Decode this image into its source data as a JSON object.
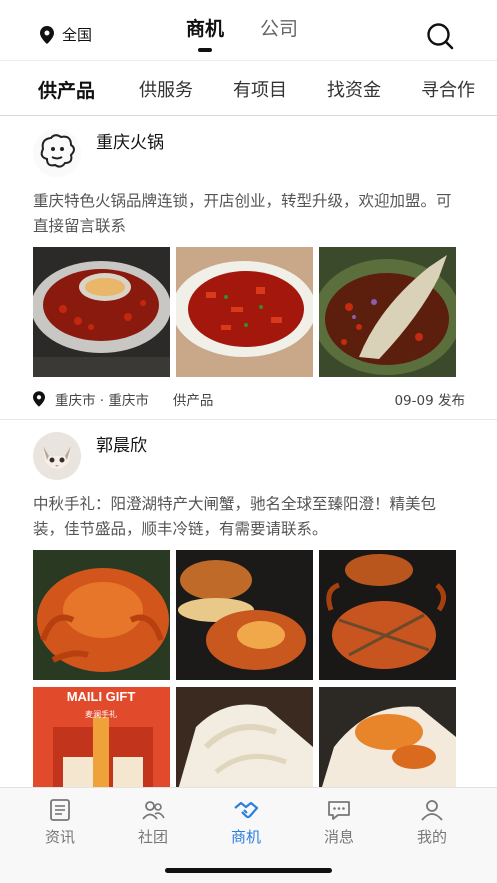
{
  "header": {
    "location": "全国",
    "tabs": [
      {
        "label": "商机",
        "active": true
      },
      {
        "label": "公司",
        "active": false
      }
    ]
  },
  "categories": [
    {
      "label": "供产品",
      "active": true
    },
    {
      "label": "供服务",
      "active": false
    },
    {
      "label": "有项目",
      "active": false
    },
    {
      "label": "找资金",
      "active": false
    },
    {
      "label": "寻合作",
      "active": false
    }
  ],
  "posts": [
    {
      "author": "重庆火锅",
      "description": "重庆特色火锅品牌连锁，开店创业，转型升级，欢迎加盟。可直接留言联系",
      "images": [
        "hotpot-image",
        "chili-chicken-image",
        "fish-image"
      ],
      "location": "重庆市 · 重庆市",
      "category": "供产品",
      "date": "09-09 发布"
    },
    {
      "author": "郭晨欣",
      "description": "中秋手礼：阳澄湖特产大闸蟹，驰名全球至臻阳澄！精美包装，佳节盛品，顺丰冷链，有需要请联系。",
      "images": [
        "crab-plate-image",
        "crab-bowl-image",
        "crab-tied-image",
        "gift-box-image",
        "crab-meat-image",
        "crab-roe-image"
      ],
      "gift_box_text": "MAILI GIFT",
      "gift_box_subtext": "麦澜手礼"
    }
  ],
  "tabbar": [
    {
      "label": "资讯",
      "icon": "news-icon",
      "active": false
    },
    {
      "label": "社团",
      "icon": "community-icon",
      "active": false
    },
    {
      "label": "商机",
      "icon": "handshake-icon",
      "active": true
    },
    {
      "label": "消息",
      "icon": "message-icon",
      "active": false
    },
    {
      "label": "我的",
      "icon": "profile-icon",
      "active": false
    }
  ],
  "colors": {
    "accent": "#2b7fe0",
    "text": "#222222",
    "muted": "#777777"
  }
}
